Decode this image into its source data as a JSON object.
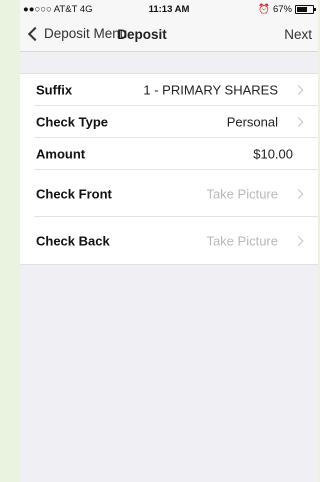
{
  "status_bar": {
    "carrier": "●●○○○ AT&T  4G",
    "time": "11:13 AM",
    "alarm_icon": "alarm-icon",
    "battery_percent": "67%",
    "battery_level": 0.67
  },
  "nav": {
    "back_label": "Deposit Menu",
    "title": "Deposit",
    "next_label": "Next"
  },
  "form": {
    "rows": [
      {
        "label": "Suffix",
        "value": "1 - PRIMARY SHARES"
      },
      {
        "label": "Check Type",
        "value": "Personal"
      },
      {
        "label": "Amount",
        "value": "$10.00"
      },
      {
        "label": "Check Front",
        "value": "Take Picture"
      },
      {
        "label": "Check Back",
        "value": "Take Picture"
      }
    ]
  }
}
